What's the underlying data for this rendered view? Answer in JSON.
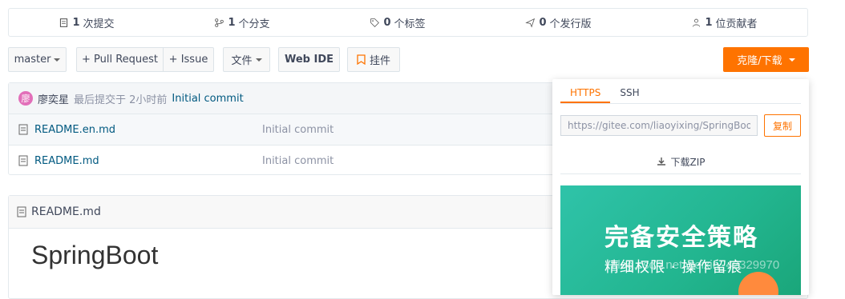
{
  "stats": [
    {
      "num": "1",
      "label": "次提交",
      "icon": "commit-icon"
    },
    {
      "num": "1",
      "label": "个分支",
      "icon": "branch-icon"
    },
    {
      "num": "0",
      "label": "个标签",
      "icon": "tag-icon"
    },
    {
      "num": "0",
      "label": "个发行版",
      "icon": "release-icon"
    },
    {
      "num": "1",
      "label": "位贡献者",
      "icon": "contributors-icon"
    }
  ],
  "toolbar": {
    "branch": "master",
    "pull_request": "+ Pull Request",
    "issue": "+ Issue",
    "files": "文件",
    "web_ide": "Web IDE",
    "widget": "挂件",
    "clone": "克隆/下载"
  },
  "commit": {
    "avatar_letter": "廖",
    "author": "廖奕星",
    "meta": "最后提交于 2小时前",
    "message": "Initial commit"
  },
  "files": [
    {
      "name": "README.en.md",
      "message": "Initial commit"
    },
    {
      "name": "README.md",
      "message": "Initial commit"
    }
  ],
  "readme": {
    "filename": "README.md",
    "title": "SpringBoot"
  },
  "clone_panel": {
    "tabs": [
      "HTTPS",
      "SSH"
    ],
    "url": "https://gitee.com/liaoyixing/SpringBoot.git",
    "copy": "复制",
    "zip": "下载ZIP",
    "ad_title": "完备安全策略",
    "ad_subtitle": "精细权限 · 操作留痕"
  },
  "watermark": "blog.csdn.net/weixin_42329970",
  "colors": {
    "accent": "#fe7300",
    "link": "#005980"
  }
}
